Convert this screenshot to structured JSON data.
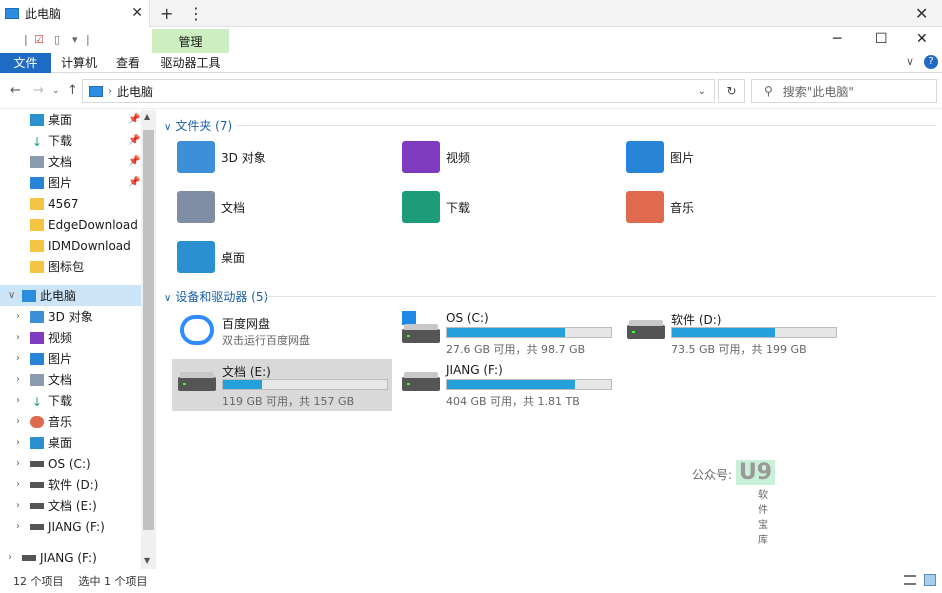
{
  "tab": {
    "title": "此电脑"
  },
  "ribbon": {
    "context_tab": "管理",
    "tabs": [
      "文件",
      "计算机",
      "查看",
      "驱动器工具"
    ]
  },
  "address": {
    "path": "此电脑",
    "search_placeholder": "搜索\"此电脑\""
  },
  "sidebar": {
    "quick": [
      {
        "label": "桌面",
        "pinned": true
      },
      {
        "label": "下载",
        "pinned": true
      },
      {
        "label": "文档",
        "pinned": true
      },
      {
        "label": "图片",
        "pinned": true
      },
      {
        "label": "4567"
      },
      {
        "label": "EdgeDownload"
      },
      {
        "label": "IDMDownload"
      },
      {
        "label": "图标包"
      }
    ],
    "this_pc": "此电脑",
    "pc_items": [
      "3D 对象",
      "视频",
      "图片",
      "文档",
      "下载",
      "音乐",
      "桌面",
      "OS (C:)",
      "软件 (D:)",
      "文档 (E:)",
      "JIANG (F:)"
    ],
    "bottom": "JIANG (F:)"
  },
  "main": {
    "folders_header": "文件夹 (7)",
    "folders": [
      {
        "name": "3D 对象",
        "color": "#3d8fd8"
      },
      {
        "name": "视频",
        "color": "#7e3bbf"
      },
      {
        "name": "图片",
        "color": "#2784d6"
      },
      {
        "name": "文档",
        "color": "#7f8ea5"
      },
      {
        "name": "下载",
        "color": "#1e9c7a"
      },
      {
        "name": "音乐",
        "color": "#e06a4d"
      },
      {
        "name": "桌面",
        "color": "#2b90cf"
      }
    ],
    "drives_header": "设备和驱动器 (5)",
    "baidu": {
      "name": "百度网盘",
      "sub": "双击运行百度网盘"
    },
    "drives": [
      {
        "name": "OS (C:)",
        "info": "27.6 GB 可用，共 98.7 GB",
        "used": 0.72
      },
      {
        "name": "软件 (D:)",
        "info": "73.5 GB 可用，共 199 GB",
        "used": 0.63
      },
      {
        "name": "文档 (E:)",
        "info": "119 GB 可用，共 157 GB",
        "used": 0.24
      },
      {
        "name": "JIANG (F:)",
        "info": "404 GB 可用，共 1.81 TB",
        "used": 0.78
      }
    ]
  },
  "status": {
    "count": "12 个项目",
    "selected": "选中 1 个项目"
  },
  "watermark": {
    "prefix": "公众号:",
    "brand": "U9",
    "sub": "软件宝库"
  }
}
